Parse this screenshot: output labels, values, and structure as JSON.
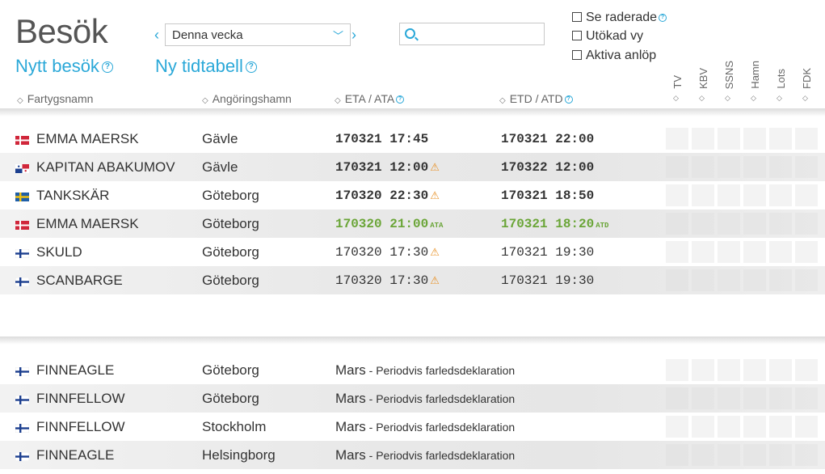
{
  "title": "Besök",
  "links": {
    "new_visit": "Nytt besök",
    "new_schedule": "Ny tidtabell"
  },
  "week_nav": {
    "prev": "‹",
    "next": "›",
    "selected": "Denna vecka"
  },
  "search": {
    "placeholder": ""
  },
  "options": {
    "show_deleted": "Se raderade",
    "extended_view": "Utökad vy",
    "active_calls": "Aktiva anlöp"
  },
  "columns": {
    "ship": "Fartygsnamn",
    "port": "Angöringshamn",
    "eta": "ETA / ATA",
    "etd": "ETD / ATD",
    "vertical": [
      "TV",
      "KBV",
      "SSNS",
      "Hamn",
      "Lots",
      "FDK"
    ]
  },
  "visits": [
    {
      "flag": "DK",
      "ship": "EMMA MAERSK",
      "port": "Gävle",
      "eta": "170321 17:45",
      "eta_tag": "",
      "eta_warn": false,
      "etd": "170321 22:00",
      "etd_tag": "",
      "style": "bold"
    },
    {
      "flag": "PA",
      "ship": "KAPITAN ABAKUMOV",
      "port": "Gävle",
      "eta": "170321 12:00",
      "eta_tag": "",
      "eta_warn": true,
      "etd": "170322 12:00",
      "etd_tag": "",
      "style": "bold"
    },
    {
      "flag": "SE",
      "ship": "TANKSKÄR",
      "port": "Göteborg",
      "eta": "170320 22:30",
      "eta_tag": "",
      "eta_warn": true,
      "etd": "170321 18:50",
      "etd_tag": "",
      "style": "bold"
    },
    {
      "flag": "DK",
      "ship": "EMMA MAERSK",
      "port": "Göteborg",
      "eta": "170320 21:00",
      "eta_tag": "ATA",
      "eta_warn": false,
      "etd": "170321 18:20",
      "etd_tag": "ATD",
      "style": "green"
    },
    {
      "flag": "FI",
      "ship": "SKULD",
      "port": "Göteborg",
      "eta": "170320 17:30",
      "eta_tag": "",
      "eta_warn": true,
      "etd": "170321 19:30",
      "etd_tag": "",
      "style": "normal"
    },
    {
      "flag": "FI",
      "ship": "SCANBARGE",
      "port": "Göteborg",
      "eta": "170320 17:30",
      "eta_tag": "",
      "eta_warn": true,
      "etd": "170321 19:30",
      "etd_tag": "",
      "style": "normal"
    }
  ],
  "declarations": [
    {
      "flag": "FI",
      "ship": "FINNEAGLE",
      "port": "Göteborg",
      "month": "Mars",
      "text": " - Periodvis farledsdeklaration"
    },
    {
      "flag": "FI",
      "ship": "FINNFELLOW",
      "port": "Göteborg",
      "month": "Mars",
      "text": " - Periodvis farledsdeklaration"
    },
    {
      "flag": "FI",
      "ship": "FINNFELLOW",
      "port": "Stockholm",
      "month": "Mars",
      "text": " - Periodvis farledsdeklaration"
    },
    {
      "flag": "FI",
      "ship": "FINNEAGLE",
      "port": "Helsingborg",
      "month": "Mars",
      "text": " - Periodvis farledsdeklaration"
    }
  ],
  "colors": {
    "accent": "#2aa8d8",
    "actual_green": "#6aa537",
    "warning": "#e8932a"
  }
}
